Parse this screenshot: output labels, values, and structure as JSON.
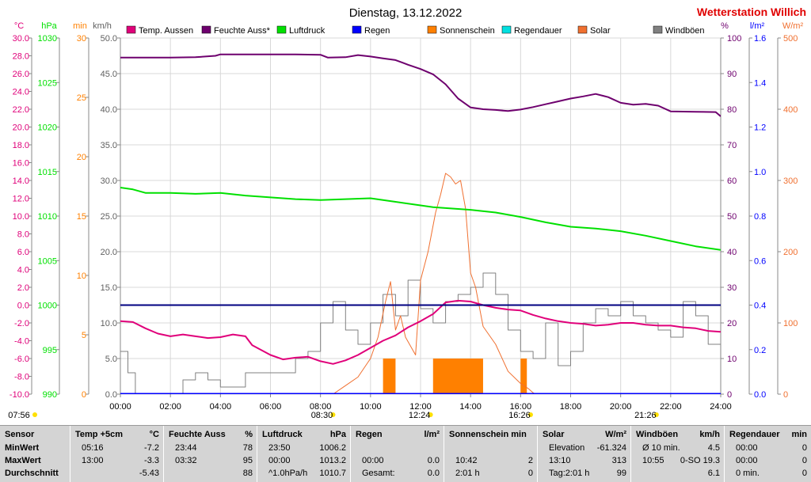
{
  "title": "Dienstag, 13.12.2022",
  "brand": "Wetterstation Willich",
  "colors": {
    "temp": "#e0007a",
    "hum": "#6e006e",
    "press": "#00e000",
    "rain": "#0000ff",
    "sun": "#ff8000",
    "rainDur": "#00e0e0",
    "solar": "#f07030",
    "gust": "#808080",
    "brand": "#e00000"
  },
  "legend": [
    {
      "label": "Temp. Aussen",
      "color": "#e0007a"
    },
    {
      "label": "Feuchte Auss*",
      "color": "#6e006e"
    },
    {
      "label": "Luftdruck",
      "color": "#00e000"
    },
    {
      "label": "Regen",
      "color": "#0000ff"
    },
    {
      "label": "Sonnenschein",
      "color": "#ff8000"
    },
    {
      "label": "Regendauer",
      "color": "#00e0e0"
    },
    {
      "label": "Solar",
      "color": "#f07030"
    },
    {
      "label": "Windböen",
      "color": "#808080"
    }
  ],
  "chart_data": {
    "type": "line",
    "title": "Dienstag, 13.12.2022",
    "x_range": [
      0,
      24
    ],
    "x_ticks": [
      "00:00",
      "02:00",
      "04:00",
      "06:00",
      "08:00",
      "10:00",
      "12:00",
      "14:00",
      "16:00",
      "18:00",
      "20:00",
      "22:00",
      "24:00"
    ],
    "grid": true,
    "axes": {
      "temp": {
        "unit": "°C",
        "range": [
          -10,
          30
        ],
        "ticks": [
          "30.0",
          "28.0",
          "26.0",
          "24.0",
          "22.0",
          "20.0",
          "18.0",
          "16.0",
          "14.0",
          "12.0",
          "10.0",
          "8.0",
          "6.0",
          "4.0",
          "2.0",
          "0.0",
          "-2.0",
          "-4.0",
          "-6.0",
          "-8.0",
          "-10.0"
        ]
      },
      "press": {
        "unit": "hPa",
        "range": [
          990,
          1030
        ],
        "ticks": [
          "1030",
          "1025",
          "1020",
          "1015",
          "1010",
          "1005",
          "1000",
          "995",
          "990"
        ]
      },
      "sun": {
        "unit": "min",
        "range": [
          0,
          30
        ],
        "ticks": [
          "30",
          "25",
          "20",
          "15",
          "10",
          "5",
          "0"
        ]
      },
      "wind": {
        "unit": "km/h",
        "range": [
          0,
          50
        ],
        "ticks": [
          "50.0",
          "45.0",
          "40.0",
          "35.0",
          "30.0",
          "25.0",
          "20.0",
          "15.0",
          "10.0",
          "5.0",
          "0.0"
        ]
      },
      "hum": {
        "unit": "%",
        "range": [
          0,
          100
        ],
        "ticks": [
          "100",
          "90",
          "80",
          "70",
          "60",
          "50",
          "40",
          "30",
          "20",
          "10",
          "0"
        ]
      },
      "rain": {
        "unit": "l/m²",
        "range": [
          0,
          1.6
        ],
        "ticks": [
          "1.6",
          "1.4",
          "1.2",
          "1.0",
          "0.8",
          "0.6",
          "0.4",
          "0.2",
          "0.0"
        ]
      },
      "solar": {
        "unit": "W/m²",
        "range": [
          0,
          500
        ],
        "ticks": [
          "500",
          "400",
          "300",
          "200",
          "100",
          "0"
        ]
      }
    },
    "series": [
      {
        "name": "Temp. Aussen",
        "axis": "temp",
        "points": [
          [
            0,
            -1.8
          ],
          [
            0.5,
            -1.9
          ],
          [
            1,
            -2.6
          ],
          [
            1.5,
            -3.2
          ],
          [
            2,
            -3.5
          ],
          [
            2.5,
            -3.3
          ],
          [
            3,
            -3.5
          ],
          [
            3.5,
            -3.7
          ],
          [
            4,
            -3.6
          ],
          [
            4.5,
            -3.3
          ],
          [
            5,
            -3.5
          ],
          [
            5.27,
            -4.5
          ],
          [
            6,
            -5.6
          ],
          [
            6.5,
            -6.1
          ],
          [
            7,
            -5.9
          ],
          [
            7.5,
            -5.8
          ],
          [
            8,
            -6.3
          ],
          [
            8.5,
            -6.6
          ],
          [
            9,
            -6.2
          ],
          [
            9.5,
            -5.6
          ],
          [
            10,
            -4.8
          ],
          [
            10.5,
            -4.0
          ],
          [
            11,
            -3.4
          ],
          [
            11.5,
            -2.5
          ],
          [
            12,
            -1.8
          ],
          [
            12.5,
            -1.0
          ],
          [
            13,
            0.3
          ],
          [
            13.5,
            0.5
          ],
          [
            14,
            0.4
          ],
          [
            14.5,
            0.0
          ],
          [
            15,
            -0.3
          ],
          [
            15.5,
            -0.5
          ],
          [
            16,
            -0.6
          ],
          [
            16.5,
            -1.1
          ],
          [
            17,
            -1.5
          ],
          [
            17.5,
            -1.8
          ],
          [
            18,
            -2.0
          ],
          [
            18.5,
            -2.1
          ],
          [
            19,
            -2.3
          ],
          [
            19.5,
            -2.2
          ],
          [
            20,
            -2.0
          ],
          [
            20.5,
            -2.0
          ],
          [
            21,
            -2.2
          ],
          [
            21.5,
            -2.3
          ],
          [
            22,
            -2.3
          ],
          [
            22.5,
            -2.5
          ],
          [
            23,
            -2.6
          ],
          [
            23.5,
            -2.9
          ],
          [
            24,
            -3.0
          ]
        ]
      },
      {
        "name": "Feuchte Auss*",
        "axis": "hum",
        "points": [
          [
            0,
            94.5
          ],
          [
            1,
            94.5
          ],
          [
            2,
            94.5
          ],
          [
            3,
            94.6
          ],
          [
            3.8,
            95.0
          ],
          [
            4,
            95.4
          ],
          [
            5,
            95.4
          ],
          [
            6,
            95.4
          ],
          [
            7,
            95.4
          ],
          [
            8,
            95.3
          ],
          [
            8.3,
            94.5
          ],
          [
            9,
            94.6
          ],
          [
            9.5,
            95.2
          ],
          [
            10,
            94.8
          ],
          [
            10.5,
            94.3
          ],
          [
            11,
            93.8
          ],
          [
            11.5,
            92.5
          ],
          [
            12,
            91.3
          ],
          [
            12.5,
            89.8
          ],
          [
            13,
            87.0
          ],
          [
            13.5,
            83.0
          ],
          [
            14,
            80.5
          ],
          [
            14.5,
            80.0
          ],
          [
            15,
            79.8
          ],
          [
            15.5,
            79.5
          ],
          [
            16,
            79.9
          ],
          [
            16.5,
            80.6
          ],
          [
            17,
            81.4
          ],
          [
            17.5,
            82.2
          ],
          [
            18,
            83.0
          ],
          [
            18.5,
            83.6
          ],
          [
            19,
            84.3
          ],
          [
            19.5,
            83.4
          ],
          [
            20,
            81.8
          ],
          [
            20.5,
            81.3
          ],
          [
            21,
            81.5
          ],
          [
            21.5,
            81.0
          ],
          [
            22,
            79.4
          ],
          [
            23,
            79.3
          ],
          [
            23.8,
            79.2
          ],
          [
            24,
            78.0
          ]
        ]
      },
      {
        "name": "Luftdruck",
        "axis": "press",
        "points": [
          [
            0,
            1013.2
          ],
          [
            0.5,
            1013.0
          ],
          [
            1,
            1012.6
          ],
          [
            2,
            1012.6
          ],
          [
            3,
            1012.5
          ],
          [
            4,
            1012.6
          ],
          [
            5,
            1012.3
          ],
          [
            6,
            1012.1
          ],
          [
            7,
            1011.9
          ],
          [
            8,
            1011.8
          ],
          [
            9,
            1011.9
          ],
          [
            10,
            1012.0
          ],
          [
            11,
            1011.6
          ],
          [
            12,
            1011.2
          ],
          [
            12.5,
            1011.0
          ],
          [
            13,
            1010.9
          ],
          [
            14,
            1010.7
          ],
          [
            15,
            1010.4
          ],
          [
            16,
            1009.9
          ],
          [
            17,
            1009.3
          ],
          [
            18,
            1008.8
          ],
          [
            19,
            1008.6
          ],
          [
            20,
            1008.3
          ],
          [
            21,
            1007.8
          ],
          [
            22,
            1007.2
          ],
          [
            23,
            1006.6
          ],
          [
            24,
            1006.2
          ]
        ]
      },
      {
        "name": "Regen",
        "axis": "rain",
        "points": [
          [
            0,
            0
          ],
          [
            24,
            0
          ]
        ]
      },
      {
        "name": "Solar",
        "axis": "solar",
        "points": [
          [
            8.5,
            0
          ],
          [
            9,
            12
          ],
          [
            9.5,
            24
          ],
          [
            10,
            50
          ],
          [
            10.3,
            80
          ],
          [
            10.6,
            130
          ],
          [
            10.8,
            158
          ],
          [
            11,
            90
          ],
          [
            11.2,
            110
          ],
          [
            11.4,
            80
          ],
          [
            11.8,
            55
          ],
          [
            12,
            160
          ],
          [
            12.3,
            200
          ],
          [
            12.6,
            255
          ],
          [
            12.8,
            280
          ],
          [
            13,
            310
          ],
          [
            13.2,
            305
          ],
          [
            13.4,
            295
          ],
          [
            13.6,
            300
          ],
          [
            13.8,
            260
          ],
          [
            14,
            170
          ],
          [
            14.2,
            150
          ],
          [
            14.5,
            95
          ],
          [
            15,
            70
          ],
          [
            15.5,
            32
          ],
          [
            16,
            15
          ],
          [
            16.3,
            8
          ],
          [
            16.5,
            2
          ],
          [
            16.6,
            0
          ]
        ]
      },
      {
        "name": "Windböen",
        "axis": "wind",
        "points": [
          [
            0,
            6
          ],
          [
            0.3,
            3
          ],
          [
            0.6,
            0
          ],
          [
            1,
            0
          ],
          [
            2,
            0
          ],
          [
            2.5,
            2
          ],
          [
            3,
            3
          ],
          [
            3.5,
            2
          ],
          [
            4,
            1
          ],
          [
            5,
            3
          ],
          [
            6,
            3
          ],
          [
            7,
            5
          ],
          [
            7.5,
            6
          ],
          [
            8,
            10
          ],
          [
            8.5,
            13
          ],
          [
            9,
            9
          ],
          [
            9.5,
            7
          ],
          [
            10,
            10
          ],
          [
            10.5,
            14
          ],
          [
            11,
            11
          ],
          [
            11.5,
            16
          ],
          [
            12,
            12
          ],
          [
            12.5,
            10
          ],
          [
            13,
            13
          ],
          [
            13.5,
            14
          ],
          [
            14,
            15
          ],
          [
            14.5,
            17
          ],
          [
            15,
            14
          ],
          [
            15.5,
            9
          ],
          [
            16,
            6
          ],
          [
            16.5,
            5
          ],
          [
            17,
            10
          ],
          [
            17.5,
            4
          ],
          [
            18,
            6
          ],
          [
            18.5,
            10
          ],
          [
            19,
            12
          ],
          [
            19.5,
            11
          ],
          [
            20,
            13
          ],
          [
            20.5,
            11
          ],
          [
            21,
            10
          ],
          [
            21.5,
            9
          ],
          [
            22,
            8
          ],
          [
            22.5,
            13
          ],
          [
            23,
            11
          ],
          [
            23.5,
            7
          ],
          [
            24,
            5
          ]
        ]
      }
    ],
    "sunshine_blocks": [
      [
        10.5,
        11.0,
        3
      ],
      [
        12.5,
        14.5,
        3
      ],
      [
        16.0,
        16.25,
        3
      ]
    ],
    "reference_line": {
      "axis": "temp",
      "value": 0.0
    },
    "time_marks": [
      {
        "time": "07:56",
        "x": 0
      },
      {
        "time": "08:30",
        "x": 8.5
      },
      {
        "time": "12:24",
        "x": 12.4
      },
      {
        "time": "16:26",
        "x": 16.4
      },
      {
        "time": "21:26",
        "x": 21.43
      }
    ]
  },
  "stats": {
    "col1": {
      "title": "Sensor",
      "rows": [
        "MinWert",
        "MaxWert",
        "Durchschnitt"
      ]
    },
    "col2": {
      "title": "Temp +5cm",
      "unit": "°C",
      "rows": [
        [
          "05:16",
          "-7.2"
        ],
        [
          "13:00",
          "-3.3"
        ],
        [
          "",
          "-5.43"
        ]
      ]
    },
    "col3": {
      "title": "Feuchte Auss",
      "unit": "%",
      "rows": [
        [
          "23:44",
          "78"
        ],
        [
          "03:32",
          "95"
        ],
        [
          "",
          "88"
        ]
      ]
    },
    "col4": {
      "title": "Luftdruck",
      "unit": "hPa",
      "rows": [
        [
          "23:50",
          "1006.2"
        ],
        [
          "00:00",
          "1013.2"
        ],
        [
          "^1.0hPa/h",
          "1010.7"
        ]
      ]
    },
    "col5": {
      "title": "Regen",
      "unit": "l/m²",
      "rows": [
        [
          "",
          ""
        ],
        [
          "00:00",
          "0.0"
        ],
        [
          "Gesamt:",
          "0.0"
        ]
      ]
    },
    "col6": {
      "title": "Sonnenschein min",
      "unit": "",
      "rows": [
        [
          "",
          ""
        ],
        [
          "10:42",
          "2"
        ],
        [
          "2:01 h",
          "0"
        ]
      ]
    },
    "col7": {
      "title": "Solar",
      "unit": "W/m²",
      "rows": [
        [
          "Elevation",
          "-61.324"
        ],
        [
          "13:10",
          "313"
        ],
        [
          "Tag:2:01 h",
          "99"
        ]
      ]
    },
    "col8": {
      "title": "Windböen",
      "unit": "km/h",
      "rows": [
        [
          "Ø 10 min.",
          "4.5"
        ],
        [
          "10:55",
          "0-SO 19.3"
        ],
        [
          "",
          "6.1"
        ]
      ]
    },
    "col9": {
      "title": "Regendauer",
      "unit": "min",
      "rows": [
        [
          "00:00",
          "0"
        ],
        [
          "00:00",
          "0"
        ],
        [
          "0 min.",
          "0"
        ]
      ]
    }
  }
}
